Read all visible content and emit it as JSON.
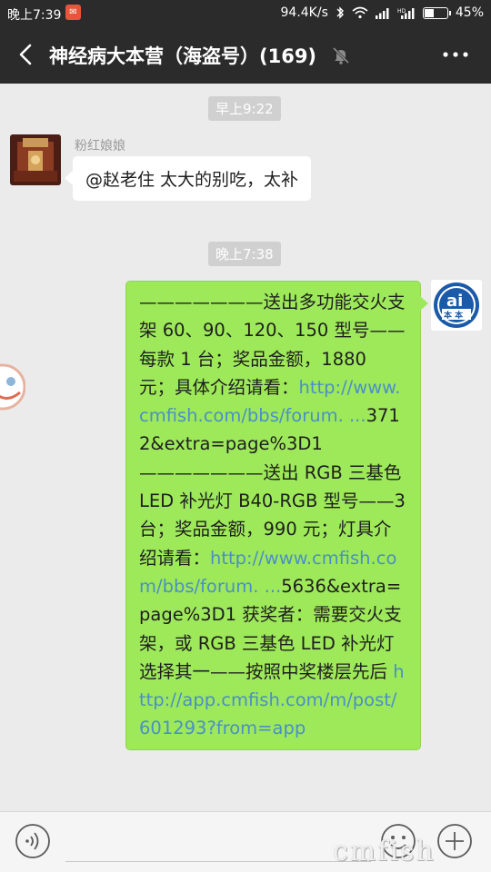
{
  "status_bar": {
    "time": "晚上7:39",
    "network_speed": "94.4K/s",
    "battery": "45%",
    "battery_level": 0.45,
    "icons": [
      "app-notification-icon",
      "bluetooth-icon",
      "wifi-icon",
      "signal-icon",
      "hd-signal-icon",
      "battery-icon"
    ]
  },
  "nav": {
    "title": "神经病大本营（海盗号）(169)",
    "icons": [
      "back-arrow-icon",
      "mute-bell-icon",
      "more-dots-icon"
    ]
  },
  "messages": {
    "timestamp_1": "早上9:22",
    "msg1_sender": "粉红娘娘",
    "msg1_text": "@赵老住  太大的别吃，太补",
    "timestamp_2": "晚上7:38",
    "msg2": {
      "t1": "———————送出多功能交火支架 60、90、120、150 型号——每款 1 台；奖品金额，1880 元；具体介绍请看：",
      "l1": "http://www.cmfish.com/bbs/forum. ...",
      "t2": "3712&extra=page%3D1 ———————送出 RGB 三基色 LED 补光灯 B40-RGB 型号——3 台；奖品金额，990 元；灯具介绍请看：",
      "l2": "http://www.cmfish.com/bbs/forum. ...",
      "t3": "5636&extra=page%3D1 获奖者：需要交火支架，或 RGB 三基色 LED 补光灯选择其一——按照中奖楼层先后 ",
      "l3": "http://app.cmfish.com/m/post/601293?from=app"
    }
  },
  "input_bar": {
    "icons": [
      "voice-icon",
      "emoji-icon",
      "plus-icon"
    ]
  },
  "watermark": "cmfish"
}
